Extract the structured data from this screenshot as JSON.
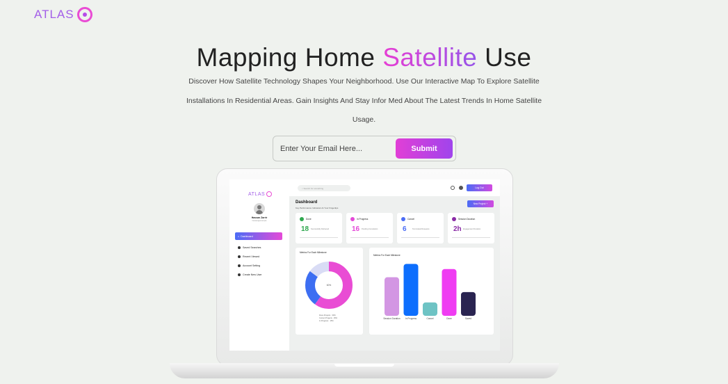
{
  "brand": {
    "name": "ATLAS"
  },
  "hero": {
    "title_start": "Mapping Home",
    "title_accent": "Satellite",
    "title_end": "Use",
    "description": "Discover How Satellite Technology Shapes Your Neighborhood. Use Our Interactive Map To Explore Satellite Installations In Residential Areas. Gain Insights And Stay Infor Med About The Latest Trends In Home Satellite Usage."
  },
  "signup": {
    "email_placeholder": "Enter Your Email Here...",
    "submit_label": "Submit"
  },
  "colors": {
    "accent_pink": "#e13fd6",
    "accent_purple": "#a044ec",
    "accent_blue": "#4b6cf5",
    "page_bg": "#eff2ee"
  },
  "dashboard": {
    "logo": "ATLAS",
    "user": {
      "name": "Hassan Zarrir",
      "role": "hassan@example"
    },
    "nav": {
      "active": "Dashboard",
      "items": [
        "Saved Searches",
        "Recent Viewed",
        "Account Setting",
        "Create New User"
      ]
    },
    "search_placeholder": "Search for something",
    "logout_label": "Log Out",
    "title": "Dashboard",
    "subtitle": "Key Performance Indicators At Your Fingertips",
    "new_project_label": "New Project +",
    "stats": [
      {
        "label": "Done",
        "value": "18",
        "note": "Successfully Delivered",
        "color": "#2fa84f"
      },
      {
        "label": "In Progress",
        "value": "16",
        "note": "Pending Completion",
        "color": "#e44ad8"
      },
      {
        "label": "Cancel",
        "value": "6",
        "note": "Terminated Requests",
        "color": "#4b6cf5"
      },
      {
        "label": "Session Duration",
        "value": "2h",
        "note": "Engagement Duration",
        "color": "#8a2aa6"
      }
    ],
    "donut_panel_title": "Metrics For Each Milestone",
    "bar_panel_title": "Metrics For Each Milestone",
    "donut_center": "60%",
    "donut_legend": [
      {
        "label": "Done Projects",
        "value": "60%"
      },
      {
        "label": "Current Projects",
        "value": "25%"
      },
      {
        "label": "In Progress",
        "value": "15%"
      }
    ]
  },
  "chart_data": [
    {
      "type": "pie",
      "title": "Metrics For Each Milestone",
      "categories": [
        "Done Projects",
        "Current Projects",
        "In Progress"
      ],
      "values": [
        60,
        25,
        15
      ],
      "colors": [
        "#e94cd4",
        "#3d6ef2",
        "#d9dcf5"
      ]
    },
    {
      "type": "bar",
      "title": "Metrics For Each Milestone",
      "categories": [
        "Session Duration",
        "In Progress",
        "Cancel",
        "Done",
        "Saved"
      ],
      "values": [
        52,
        70,
        18,
        63,
        32
      ],
      "colors": [
        "#d396e3",
        "#0d6efd",
        "#6ec3c4",
        "#ef3cf2",
        "#2a2451"
      ],
      "ylim": [
        0,
        75
      ]
    }
  ]
}
